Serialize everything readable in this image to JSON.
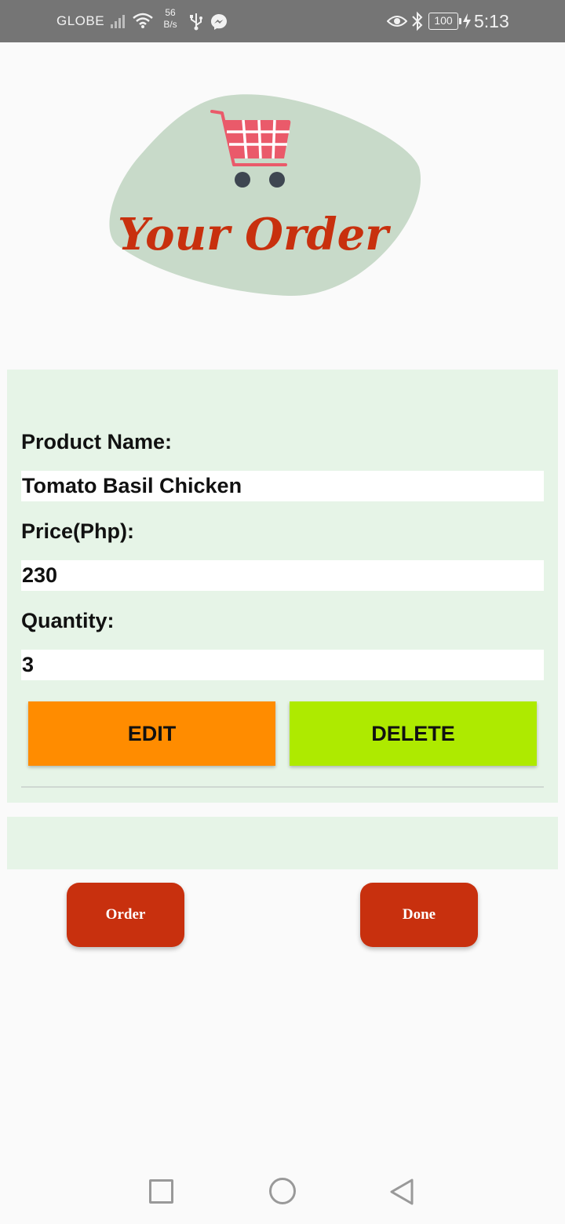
{
  "status_bar": {
    "carrier": "GLOBE",
    "net_speed_value": "56",
    "net_speed_unit": "B/s",
    "battery": "100",
    "time": "5:13",
    "icons": [
      "signal-icon",
      "wifi-icon",
      "usb-icon",
      "messenger-icon",
      "eye-icon",
      "bluetooth-icon",
      "battery-icon",
      "charging-icon"
    ]
  },
  "header": {
    "logo_text": "Your Order",
    "logo_icon": "shopping-cart-icon"
  },
  "order": {
    "product_label": "Product Name:",
    "product_value": "Tomato Basil Chicken",
    "price_label": "Price(Php):",
    "price_value": "230",
    "quantity_label": "Quantity:",
    "quantity_value": "3",
    "edit_label": "EDIT",
    "delete_label": "DELETE"
  },
  "actions": {
    "order_label": "Order",
    "done_label": "Done"
  },
  "nav_bar": {
    "icons": [
      "recents-icon",
      "home-icon",
      "back-icon"
    ]
  },
  "colors": {
    "edit_button": "#ff8c00",
    "delete_button": "#aeea00",
    "action_button": "#c8300e",
    "card_background": "#e6f4e7",
    "logo_blob": "#c8dac9",
    "logo_text": "#c8300e",
    "cart": "#ea5a6a"
  }
}
